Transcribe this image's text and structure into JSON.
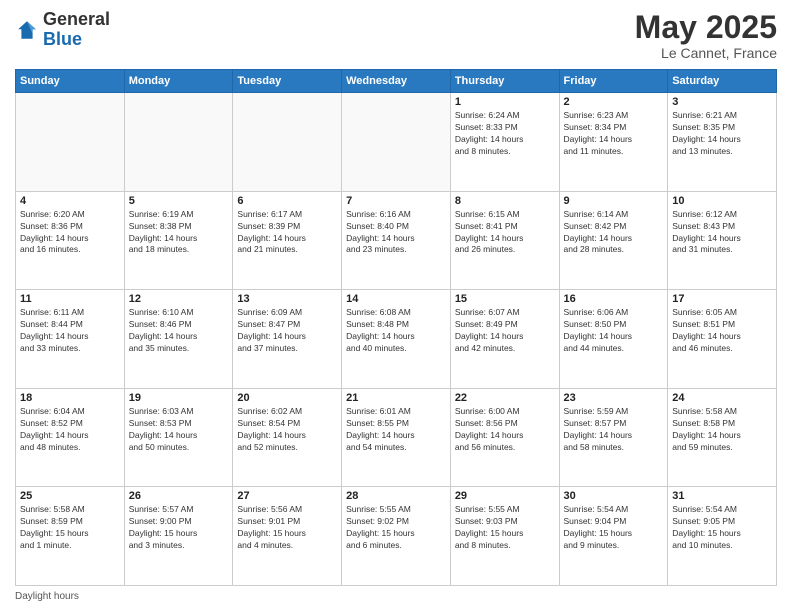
{
  "header": {
    "logo_general": "General",
    "logo_blue": "Blue",
    "month_title": "May 2025",
    "location": "Le Cannet, France"
  },
  "days_of_week": [
    "Sunday",
    "Monday",
    "Tuesday",
    "Wednesday",
    "Thursday",
    "Friday",
    "Saturday"
  ],
  "legend": "Daylight hours",
  "weeks": [
    [
      {
        "day": "",
        "info": ""
      },
      {
        "day": "",
        "info": ""
      },
      {
        "day": "",
        "info": ""
      },
      {
        "day": "",
        "info": ""
      },
      {
        "day": "1",
        "info": "Sunrise: 6:24 AM\nSunset: 8:33 PM\nDaylight: 14 hours\nand 8 minutes."
      },
      {
        "day": "2",
        "info": "Sunrise: 6:23 AM\nSunset: 8:34 PM\nDaylight: 14 hours\nand 11 minutes."
      },
      {
        "day": "3",
        "info": "Sunrise: 6:21 AM\nSunset: 8:35 PM\nDaylight: 14 hours\nand 13 minutes."
      }
    ],
    [
      {
        "day": "4",
        "info": "Sunrise: 6:20 AM\nSunset: 8:36 PM\nDaylight: 14 hours\nand 16 minutes."
      },
      {
        "day": "5",
        "info": "Sunrise: 6:19 AM\nSunset: 8:38 PM\nDaylight: 14 hours\nand 18 minutes."
      },
      {
        "day": "6",
        "info": "Sunrise: 6:17 AM\nSunset: 8:39 PM\nDaylight: 14 hours\nand 21 minutes."
      },
      {
        "day": "7",
        "info": "Sunrise: 6:16 AM\nSunset: 8:40 PM\nDaylight: 14 hours\nand 23 minutes."
      },
      {
        "day": "8",
        "info": "Sunrise: 6:15 AM\nSunset: 8:41 PM\nDaylight: 14 hours\nand 26 minutes."
      },
      {
        "day": "9",
        "info": "Sunrise: 6:14 AM\nSunset: 8:42 PM\nDaylight: 14 hours\nand 28 minutes."
      },
      {
        "day": "10",
        "info": "Sunrise: 6:12 AM\nSunset: 8:43 PM\nDaylight: 14 hours\nand 31 minutes."
      }
    ],
    [
      {
        "day": "11",
        "info": "Sunrise: 6:11 AM\nSunset: 8:44 PM\nDaylight: 14 hours\nand 33 minutes."
      },
      {
        "day": "12",
        "info": "Sunrise: 6:10 AM\nSunset: 8:46 PM\nDaylight: 14 hours\nand 35 minutes."
      },
      {
        "day": "13",
        "info": "Sunrise: 6:09 AM\nSunset: 8:47 PM\nDaylight: 14 hours\nand 37 minutes."
      },
      {
        "day": "14",
        "info": "Sunrise: 6:08 AM\nSunset: 8:48 PM\nDaylight: 14 hours\nand 40 minutes."
      },
      {
        "day": "15",
        "info": "Sunrise: 6:07 AM\nSunset: 8:49 PM\nDaylight: 14 hours\nand 42 minutes."
      },
      {
        "day": "16",
        "info": "Sunrise: 6:06 AM\nSunset: 8:50 PM\nDaylight: 14 hours\nand 44 minutes."
      },
      {
        "day": "17",
        "info": "Sunrise: 6:05 AM\nSunset: 8:51 PM\nDaylight: 14 hours\nand 46 minutes."
      }
    ],
    [
      {
        "day": "18",
        "info": "Sunrise: 6:04 AM\nSunset: 8:52 PM\nDaylight: 14 hours\nand 48 minutes."
      },
      {
        "day": "19",
        "info": "Sunrise: 6:03 AM\nSunset: 8:53 PM\nDaylight: 14 hours\nand 50 minutes."
      },
      {
        "day": "20",
        "info": "Sunrise: 6:02 AM\nSunset: 8:54 PM\nDaylight: 14 hours\nand 52 minutes."
      },
      {
        "day": "21",
        "info": "Sunrise: 6:01 AM\nSunset: 8:55 PM\nDaylight: 14 hours\nand 54 minutes."
      },
      {
        "day": "22",
        "info": "Sunrise: 6:00 AM\nSunset: 8:56 PM\nDaylight: 14 hours\nand 56 minutes."
      },
      {
        "day": "23",
        "info": "Sunrise: 5:59 AM\nSunset: 8:57 PM\nDaylight: 14 hours\nand 58 minutes."
      },
      {
        "day": "24",
        "info": "Sunrise: 5:58 AM\nSunset: 8:58 PM\nDaylight: 14 hours\nand 59 minutes."
      }
    ],
    [
      {
        "day": "25",
        "info": "Sunrise: 5:58 AM\nSunset: 8:59 PM\nDaylight: 15 hours\nand 1 minute."
      },
      {
        "day": "26",
        "info": "Sunrise: 5:57 AM\nSunset: 9:00 PM\nDaylight: 15 hours\nand 3 minutes."
      },
      {
        "day": "27",
        "info": "Sunrise: 5:56 AM\nSunset: 9:01 PM\nDaylight: 15 hours\nand 4 minutes."
      },
      {
        "day": "28",
        "info": "Sunrise: 5:55 AM\nSunset: 9:02 PM\nDaylight: 15 hours\nand 6 minutes."
      },
      {
        "day": "29",
        "info": "Sunrise: 5:55 AM\nSunset: 9:03 PM\nDaylight: 15 hours\nand 8 minutes."
      },
      {
        "day": "30",
        "info": "Sunrise: 5:54 AM\nSunset: 9:04 PM\nDaylight: 15 hours\nand 9 minutes."
      },
      {
        "day": "31",
        "info": "Sunrise: 5:54 AM\nSunset: 9:05 PM\nDaylight: 15 hours\nand 10 minutes."
      }
    ]
  ]
}
